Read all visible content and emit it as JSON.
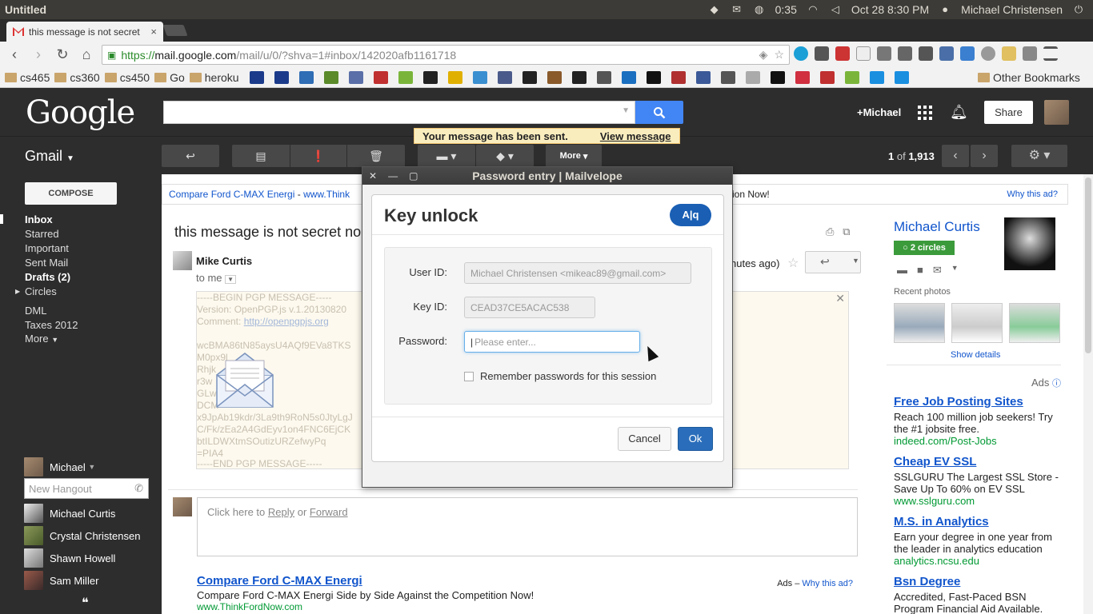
{
  "os": {
    "app_title": "Untitled",
    "clock": "0:35",
    "datetime": "Oct 28  8:30 PM",
    "user": "Michael Christensen"
  },
  "browser": {
    "tab_title": "this message is not secret",
    "tab_close": "×",
    "url_https": "https://",
    "url_host": "mail.google.com",
    "url_path": "/mail/u/0/?shva=1#inbox/142020afb1161718"
  },
  "bookmarks": {
    "folders": [
      "cs465",
      "cs360",
      "cs450",
      "Go",
      "heroku"
    ],
    "other": "Other Bookmarks",
    "icon_colors": [
      "#1b3b8a",
      "#1b3b8a",
      "#2f6db5",
      "#5a8a2a",
      "#5a6fa8",
      "#c03030",
      "#7ab53a",
      "#222",
      "#e0b000",
      "#3a8fd0",
      "#4a5a8a",
      "#222",
      "#8a5a2a",
      "#222",
      "#555",
      "#1a6fc0",
      "#111",
      "#b03030",
      "#3b5998",
      "#555",
      "#aaa",
      "#111",
      "#d03040",
      "#c03030",
      "#7ab53a",
      "#1a8fe0",
      "#1a8fe0"
    ]
  },
  "google": {
    "logo": "Google",
    "plus_name": "+Michael",
    "share_label": "Share"
  },
  "gmail": {
    "label": "Gmail",
    "more_label": "More",
    "sent_notice": "Your message has been sent.",
    "view_message": "View message",
    "pager_range": "1",
    "pager_of": "of",
    "pager_total": "1,913"
  },
  "nav": {
    "compose": "COMPOSE",
    "items": [
      "Inbox",
      "Starred",
      "Important",
      "Sent Mail",
      "Drafts (2)",
      "Circles",
      "DML",
      "Taxes 2012",
      "More"
    ],
    "hangout_user": "Michael",
    "hangout_placeholder": "New Hangout",
    "contacts": [
      "Michael Curtis",
      "Crystal Christensen",
      "Shawn Howell",
      "Sam Miller"
    ]
  },
  "ad_top": {
    "title": "Compare Ford C-MAX Energi",
    "dash": "-",
    "url": "www.Think",
    "tail": "ion Now!",
    "why": "Why this ad?"
  },
  "message": {
    "subject": "this message is not secret no",
    "sender": "Mike Curtis",
    "to": "to me",
    "time": "nutes ago)",
    "pgp_lines": [
      "-----BEGIN PGP MESSAGE-----",
      "Version: OpenPGP.js v.1.20130820",
      "Comment: ",
      "",
      "wcBMA86tN85aysU4AQf9EVa8TKS",
      "M0px9l",
      "Rhjk",
      "r3w",
      "GLw",
      "DCM",
      "x9JpAb19kdr/3La9th9RoN5s0JtyLgJ",
      "C/Fk/zEa2A4GdEyv1on4FNC6EjCK",
      "btILDWXtmSOutizURZefwyPq",
      "=PIA4",
      "-----END PGP MESSAGE-----"
    ],
    "pgp_link": "http://openpgpjs.org",
    "reply_prefix": "Click here to ",
    "reply_link": "Reply",
    "reply_or": " or ",
    "forward_link": "Forward"
  },
  "ad_bottom": {
    "title": "Compare Ford C-MAX Energi",
    "text": "Compare Ford C-MAX Energi Side by Side Against the Competition Now!",
    "url": "www.ThinkFordNow.com",
    "ads_label": "Ads –",
    "why": "Why this ad?"
  },
  "side": {
    "name": "Michael Curtis",
    "circles": "2 circles",
    "recent_photos": "Recent photos",
    "show_details": "Show details",
    "ads_label": "Ads",
    "ads": [
      {
        "title": "Free Job Posting Sites",
        "desc": "Reach 100 million job seekers! Try the #1 jobsite free.",
        "url": "indeed.com/Post-Jobs"
      },
      {
        "title": "Cheap EV SSL",
        "desc": "SSLGURU The Largest SSL Store - Save Up To 60% on EV SSL",
        "url": "www.sslguru.com"
      },
      {
        "title": "M.S. in Analytics",
        "desc": "Earn your degree in one year from the leader in analytics education",
        "url": "analytics.ncsu.edu"
      },
      {
        "title": "Bsn Degree",
        "desc": "Accredited, Fast-Paced BSN Program Financial Aid Available.",
        "url": ""
      }
    ]
  },
  "dialog": {
    "window_title": "Password entry | Mailvelope",
    "title": "Key unlock",
    "badge": "A|q",
    "user_id_label": "User ID:",
    "user_id_value": "Michael Christensen <mikeac89@gmail.com>",
    "key_id_label": "Key ID:",
    "key_id_value": "CEAD37CE5ACAC538",
    "password_label": "Password:",
    "password_placeholder": "Please enter...",
    "remember_label": "Remember passwords for this session",
    "cancel": "Cancel",
    "ok": "Ok"
  },
  "colors": {
    "google_blue": "#4285f4",
    "dark_bar": "#2d2d2d",
    "link": "#1155cc",
    "ad_url": "#009933",
    "mailvelope_blue": "#1a5fb4"
  }
}
